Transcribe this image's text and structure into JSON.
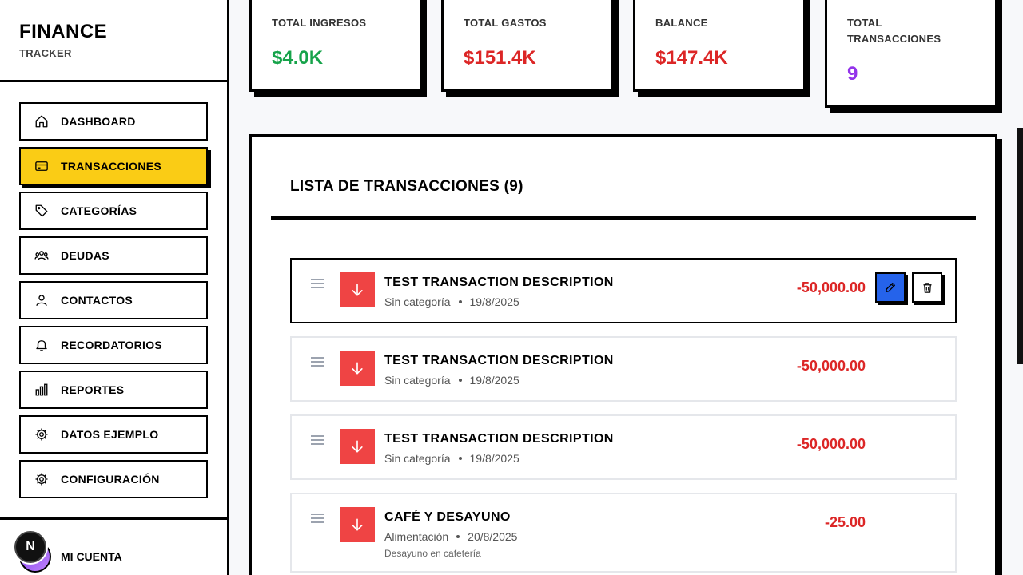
{
  "brand": {
    "title": "FINANCE",
    "subtitle": "TRACKER"
  },
  "sidebar": {
    "items": [
      {
        "label": "DASHBOARD",
        "icon": "home-icon",
        "active": false
      },
      {
        "label": "TRANSACCIONES",
        "icon": "credit-card-icon",
        "active": true
      },
      {
        "label": "CATEGORÍAS",
        "icon": "tag-icon",
        "active": false
      },
      {
        "label": "DEUDAS",
        "icon": "users-icon",
        "active": false
      },
      {
        "label": "CONTACTOS",
        "icon": "user-icon",
        "active": false
      },
      {
        "label": "RECORDATORIOS",
        "icon": "bell-icon",
        "active": false
      },
      {
        "label": "REPORTES",
        "icon": "bar-chart-icon",
        "active": false
      },
      {
        "label": "DATOS EJEMPLO",
        "icon": "gear-icon",
        "active": false
      },
      {
        "label": "CONFIGURACIÓN",
        "icon": "gear-icon",
        "active": false
      }
    ],
    "account_label": "MI CUENTA",
    "badge": "N"
  },
  "stats": {
    "income": {
      "label": "TOTAL INGRESOS",
      "value": "$4.0K",
      "color": "#16a34a"
    },
    "expenses": {
      "label": "TOTAL GASTOS",
      "value": "$151.4K",
      "color": "#dc2626"
    },
    "balance": {
      "label": "BALANCE",
      "value": "$147.4K",
      "color": "#dc2626"
    },
    "count": {
      "label_line1": "TOTAL",
      "label_line2": "TRANSACCIONES",
      "value": "9",
      "color": "#9333ea"
    }
  },
  "list": {
    "title": "LISTA DE TRANSACCIONES (9)",
    "transactions": [
      {
        "description": "TEST TRANSACTION DESCRIPTION",
        "category": "Sin categoría",
        "date": "19/8/2025",
        "amount": "-50,000.00",
        "note": ""
      },
      {
        "description": "TEST TRANSACTION DESCRIPTION",
        "category": "Sin categoría",
        "date": "19/8/2025",
        "amount": "-50,000.00",
        "note": ""
      },
      {
        "description": "TEST TRANSACTION DESCRIPTION",
        "category": "Sin categoría",
        "date": "19/8/2025",
        "amount": "-50,000.00",
        "note": ""
      },
      {
        "description": "CAFÉ Y DESAYUNO",
        "category": "Alimentación",
        "date": "20/8/2025",
        "amount": "-25.00",
        "note": "Desayuno en cafetería"
      }
    ]
  },
  "colors": {
    "accent": "#facc15",
    "expense": "#ef4444",
    "edit": "#2563eb"
  }
}
